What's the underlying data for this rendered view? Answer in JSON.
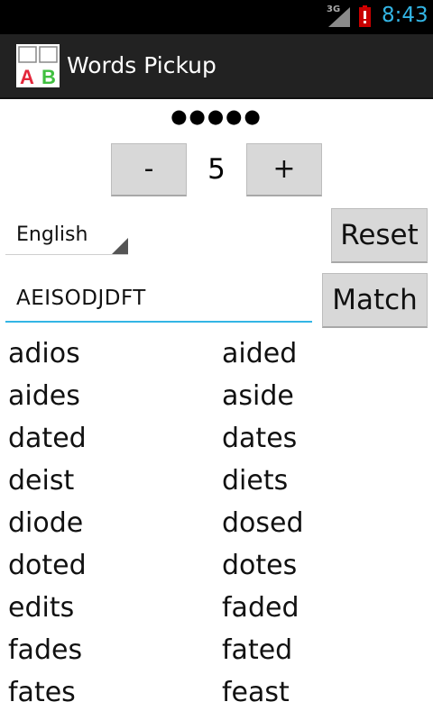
{
  "status_bar": {
    "network": "3G",
    "time": "8:43"
  },
  "app": {
    "title": "Words Pickup",
    "icon_letters": [
      "A",
      "B"
    ]
  },
  "length_selector": {
    "dots": "●●●●●",
    "minus_label": "-",
    "value": "5",
    "plus_label": "+"
  },
  "language": {
    "selected": "English"
  },
  "buttons": {
    "reset": "Reset",
    "match": "Match"
  },
  "letters_input": {
    "value": "AEISODJDFT"
  },
  "words": [
    [
      "adios",
      "aided"
    ],
    [
      "aides",
      "aside"
    ],
    [
      "dated",
      "dates"
    ],
    [
      "deist",
      "diets"
    ],
    [
      "diode",
      "dosed"
    ],
    [
      "doted",
      "dotes"
    ],
    [
      "edits",
      "faded"
    ],
    [
      "fades",
      "fated"
    ],
    [
      "fates",
      "feast"
    ]
  ],
  "colors": {
    "accent": "#33b5e5",
    "action_bar": "#222222",
    "icon_red": "#e3263a",
    "icon_green": "#3fbf3f"
  }
}
